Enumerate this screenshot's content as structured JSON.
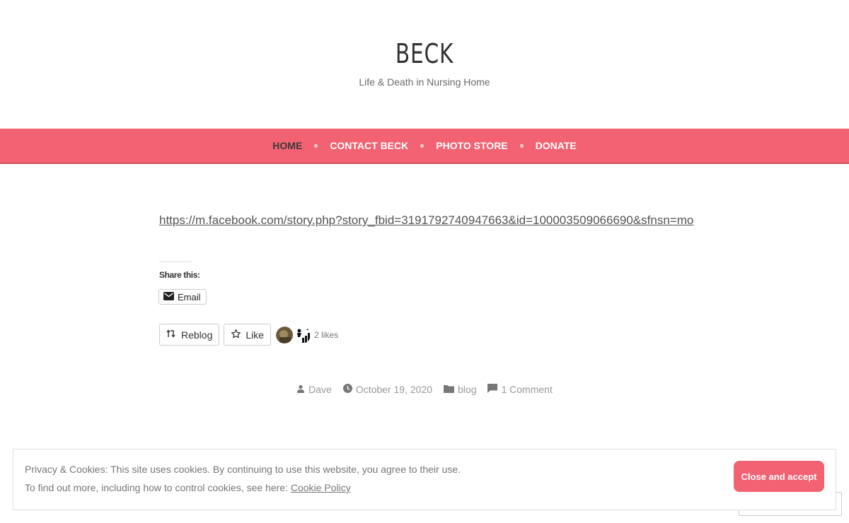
{
  "header": {
    "title": "BECK",
    "tagline": "Life & Death in Nursing Home"
  },
  "nav": {
    "items": [
      "HOME",
      "CONTACT BECK",
      "PHOTO STORE",
      "DONATE"
    ],
    "active": "HOME",
    "bar_color": "#f26272"
  },
  "post": {
    "link_text": "https://m.facebook.com/story.php?story_fbid=3191792740947663&id=100003509066690&sfnsn=mo"
  },
  "share": {
    "title": "Share this:",
    "email_label": "Email",
    "email_icon": "envelope-icon"
  },
  "likes": {
    "reblog_label": "Reblog",
    "like_label": "Like",
    "count_label": "2 likes"
  },
  "meta": {
    "author": "Dave",
    "date": "October 19, 2020",
    "category": "blog",
    "comments": "1 Comment"
  },
  "cookie": {
    "line1": "Privacy & Cookies: This site uses cookies. By continuing to use this website, you agree to their use.",
    "line2_prefix": "To find out more, including how to control cookies, see here: ",
    "policy_link": "Cookie Policy",
    "button_label": "Close and accept"
  },
  "colors": {
    "accent": "#f26272",
    "text": "#333333",
    "muted": "#999999"
  }
}
